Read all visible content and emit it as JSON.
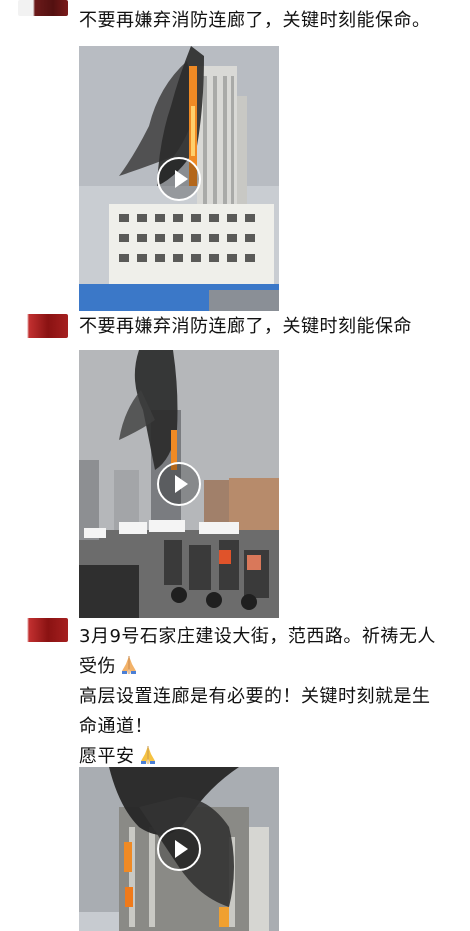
{
  "feed": {
    "posts": [
      {
        "text": "不要再嫌弃消防连廊了，关键时刻能保命。",
        "video": {
          "icon": "play-icon"
        }
      },
      {
        "text": "不要再嫌弃消防连廊了，关键时刻能保命",
        "video": {
          "icon": "play-icon"
        }
      },
      {
        "lines": [
          "3月9号石家庄建设大街，范西路。祈祷无人",
          "受伤",
          "高层设置连廊是有必要的！关键时刻就是生",
          "命通道！",
          "愿平安"
        ],
        "emoji": "pray-emoji",
        "video": {
          "icon": "play-icon"
        }
      }
    ]
  },
  "colors": {
    "text": "#111111",
    "background": "#ffffff",
    "avatar": "#9b1b1b",
    "fire": "#f08a24",
    "smoke": "#3a3a3a"
  }
}
